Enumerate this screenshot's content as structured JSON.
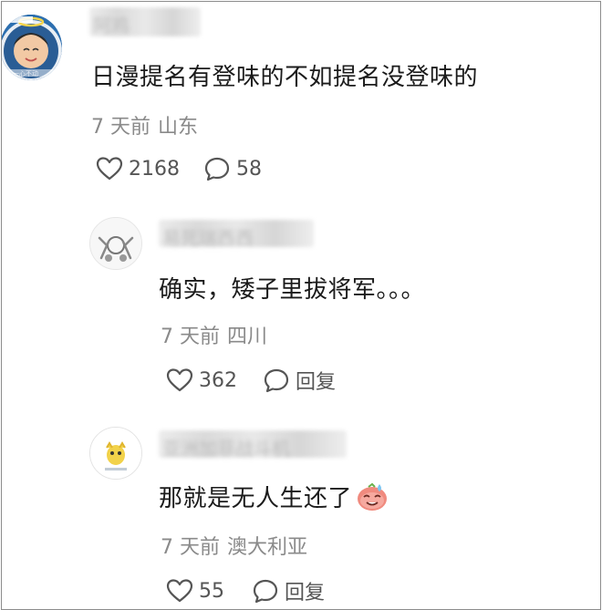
{
  "comments": [
    {
      "username": "阿鸡",
      "text": "日漫提名有登味的不如提名没登味的",
      "time": "7 天前",
      "location": "山东",
      "likes": "2168",
      "replies": "58",
      "avatar_label": "一心不动"
    },
    {
      "username": "易死瑞西西",
      "text": "确实，矮子里拔将军。。。",
      "time": "7 天前",
      "location": "四川",
      "likes": "362",
      "reply_label": "回复"
    },
    {
      "username": "亚洲加菲战斗机",
      "text": "那就是无人生还了",
      "emoji": "sweat-smile-emoji",
      "time": "7 天前",
      "location": "澳大利亚",
      "likes": "55",
      "reply_label": "回复"
    }
  ],
  "colors": {
    "text": "#1b1b1b",
    "meta": "#8a8a8a",
    "icon": "#555555",
    "avatar_bg": "#1a4f8a"
  }
}
